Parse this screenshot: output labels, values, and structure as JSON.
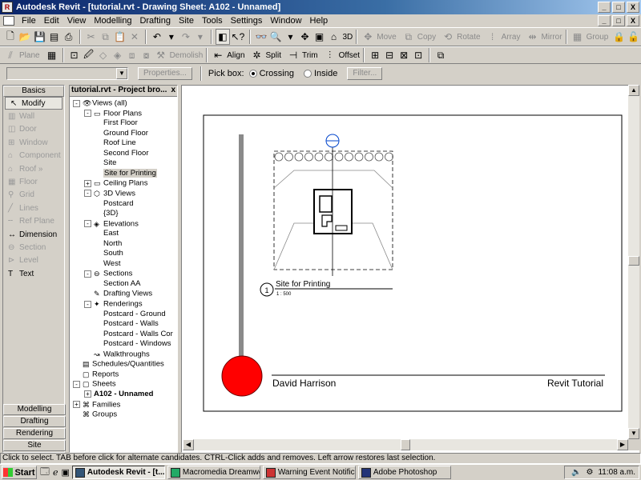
{
  "window": {
    "title": "Autodesk Revit - [tutorial.rvt - Drawing Sheet: A102 - Unnamed]",
    "buttons": [
      "_",
      "□",
      "X"
    ]
  },
  "menu": [
    "File",
    "Edit",
    "View",
    "Modelling",
    "Drafting",
    "Site",
    "Tools",
    "Settings",
    "Window",
    "Help"
  ],
  "toolbar1": {
    "view_3d": "3D",
    "move": "Move",
    "copy": "Copy",
    "rotate": "Rotate",
    "array": "Array",
    "mirror": "Mirror",
    "group": "Group"
  },
  "toolbar2": {
    "plane": "Plane",
    "demolish": "Demolish",
    "align": "Align",
    "split": "Split",
    "trim": "Trim",
    "offset": "Offset"
  },
  "options": {
    "properties": "Properties...",
    "pick_box": "Pick box:",
    "crossing": "Crossing",
    "inside": "Inside",
    "filter": "Filter..."
  },
  "designbar": {
    "header": "Basics",
    "items": [
      {
        "label": "Modify",
        "icon": "pointer-icon",
        "glyph": "↖",
        "state": "selected"
      },
      {
        "label": "Wall",
        "icon": "wall-icon",
        "glyph": "▥",
        "state": "disabled"
      },
      {
        "label": "Door",
        "icon": "door-icon",
        "glyph": "◫",
        "state": "disabled"
      },
      {
        "label": "Window",
        "icon": "window-icon",
        "glyph": "⊞",
        "state": "disabled"
      },
      {
        "label": "Component",
        "icon": "component-icon",
        "glyph": "⌂",
        "state": "disabled"
      },
      {
        "label": "Roof »",
        "icon": "roof-icon",
        "glyph": "⌂",
        "state": "disabled"
      },
      {
        "label": "Floor",
        "icon": "floor-icon",
        "glyph": "▦",
        "state": "disabled"
      },
      {
        "label": "Grid",
        "icon": "grid-icon",
        "glyph": "⚲",
        "state": "disabled"
      },
      {
        "label": "Lines",
        "icon": "lines-icon",
        "glyph": "╱",
        "state": "disabled"
      },
      {
        "label": "Ref Plane",
        "icon": "ref-plane-icon",
        "glyph": "╌",
        "state": "disabled"
      },
      {
        "label": "Dimension",
        "icon": "dimension-icon",
        "glyph": "↔",
        "state": "enabled"
      },
      {
        "label": "Section",
        "icon": "section-icon",
        "glyph": "⊖",
        "state": "disabled"
      },
      {
        "label": "Level",
        "icon": "level-icon",
        "glyph": "⊳",
        "state": "disabled"
      },
      {
        "label": "Text",
        "icon": "text-icon",
        "glyph": "T",
        "state": "enabled"
      }
    ],
    "tabs": [
      "Modelling",
      "Drafting",
      "Rendering",
      "Site"
    ]
  },
  "browser": {
    "title": "tutorial.rvt - Project bro...",
    "close": "x",
    "nodes": [
      {
        "label": "Views (all)",
        "level": 0,
        "exp": "-",
        "icon": "eye-icon",
        "glyph": "👁"
      },
      {
        "label": "Floor Plans",
        "level": 1,
        "exp": "-",
        "icon": "floor-plan-icon",
        "glyph": "▭"
      },
      {
        "label": "First Floor",
        "level": 2
      },
      {
        "label": "Ground Floor",
        "level": 2
      },
      {
        "label": "Roof Line",
        "level": 2
      },
      {
        "label": "Second Floor",
        "level": 2
      },
      {
        "label": "Site",
        "level": 2
      },
      {
        "label": "Site for Printing",
        "level": 2,
        "selected": true
      },
      {
        "label": "Ceiling Plans",
        "level": 1,
        "exp": "+",
        "icon": "ceiling-plan-icon",
        "glyph": "▭"
      },
      {
        "label": "3D Views",
        "level": 1,
        "exp": "-",
        "icon": "cube-icon",
        "glyph": "⬡"
      },
      {
        "label": "Postcard",
        "level": 2
      },
      {
        "label": "{3D}",
        "level": 2
      },
      {
        "label": "Elevations",
        "level": 1,
        "exp": "-",
        "icon": "elevation-icon",
        "glyph": "◈"
      },
      {
        "label": "East",
        "level": 2
      },
      {
        "label": "North",
        "level": 2
      },
      {
        "label": "South",
        "level": 2
      },
      {
        "label": "West",
        "level": 2
      },
      {
        "label": "Sections",
        "level": 1,
        "exp": "-",
        "icon": "section-icon",
        "glyph": "⊖"
      },
      {
        "label": "Section AA",
        "level": 2
      },
      {
        "label": "Drafting Views",
        "level": 1,
        "icon": "drafting-icon",
        "glyph": "✎"
      },
      {
        "label": "Renderings",
        "level": 1,
        "exp": "-",
        "icon": "rendering-icon",
        "glyph": "✦"
      },
      {
        "label": "Postcard - Ground",
        "level": 2
      },
      {
        "label": "Postcard - Walls",
        "level": 2
      },
      {
        "label": "Postcard - Walls Cor",
        "level": 2
      },
      {
        "label": "Postcard - Windows",
        "level": 2
      },
      {
        "label": "Walkthroughs",
        "level": 1,
        "icon": "walkthrough-icon",
        "glyph": "↝"
      },
      {
        "label": "Schedules/Quantities",
        "level": 0,
        "icon": "schedule-icon",
        "glyph": "▤"
      },
      {
        "label": "Reports",
        "level": 0,
        "icon": "report-icon",
        "glyph": "▢"
      },
      {
        "label": "Sheets",
        "level": 0,
        "exp": "-",
        "icon": "sheet-icon",
        "glyph": "▢"
      },
      {
        "label": "A102 - Unnamed",
        "level": 1,
        "exp": "+",
        "bold": true
      },
      {
        "label": "Families",
        "level": 0,
        "exp": "+",
        "icon": "families-icon",
        "glyph": "⌘"
      },
      {
        "label": "Groups",
        "level": 0,
        "icon": "groups-icon",
        "glyph": "⌘"
      }
    ]
  },
  "sheet": {
    "view_title": "Site for Printing",
    "view_number": "1",
    "scale": "1 : 500",
    "author": "David Harrison",
    "project": "Revit Tutorial"
  },
  "status": "Click to select. TAB before click for alternate candidates. CTRL-Click adds and removes. Left arrow restores last selection.",
  "taskbar": {
    "start": "Start",
    "tasks": [
      {
        "label": "Autodesk Revit - [t...",
        "active": true
      },
      {
        "label": "Macromedia Dreamwe..."
      },
      {
        "label": "Warning Event Notific..."
      },
      {
        "label": "Adobe Photoshop"
      }
    ],
    "clock": "11:08 a.m."
  }
}
